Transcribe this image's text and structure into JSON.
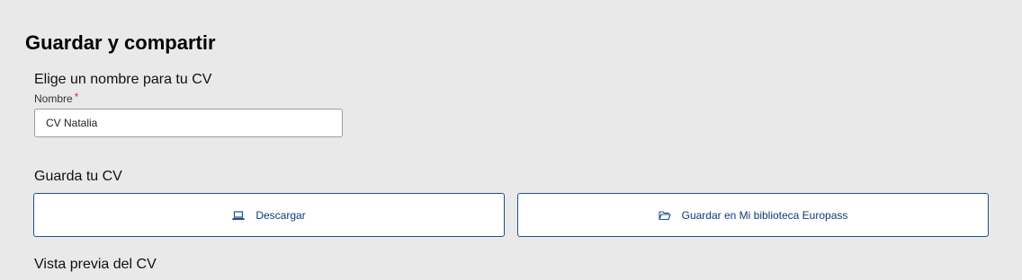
{
  "header": {
    "title": "Guardar y compartir"
  },
  "name_section": {
    "title": "Elige un nombre para tu CV",
    "field_label": "Nombre",
    "required_mark": "*",
    "field_value": "CV Natalia"
  },
  "save_section": {
    "title": "Guarda tu CV",
    "download_label": "Descargar",
    "download_icon": "laptop-icon",
    "library_label": "Guardar en Mi biblioteca Europass",
    "library_icon": "folder-open-icon"
  },
  "preview_section": {
    "title": "Vista previa del CV"
  },
  "colors": {
    "background": "#e9e9e9",
    "accent": "#1d4f91",
    "required": "#c0392b"
  }
}
